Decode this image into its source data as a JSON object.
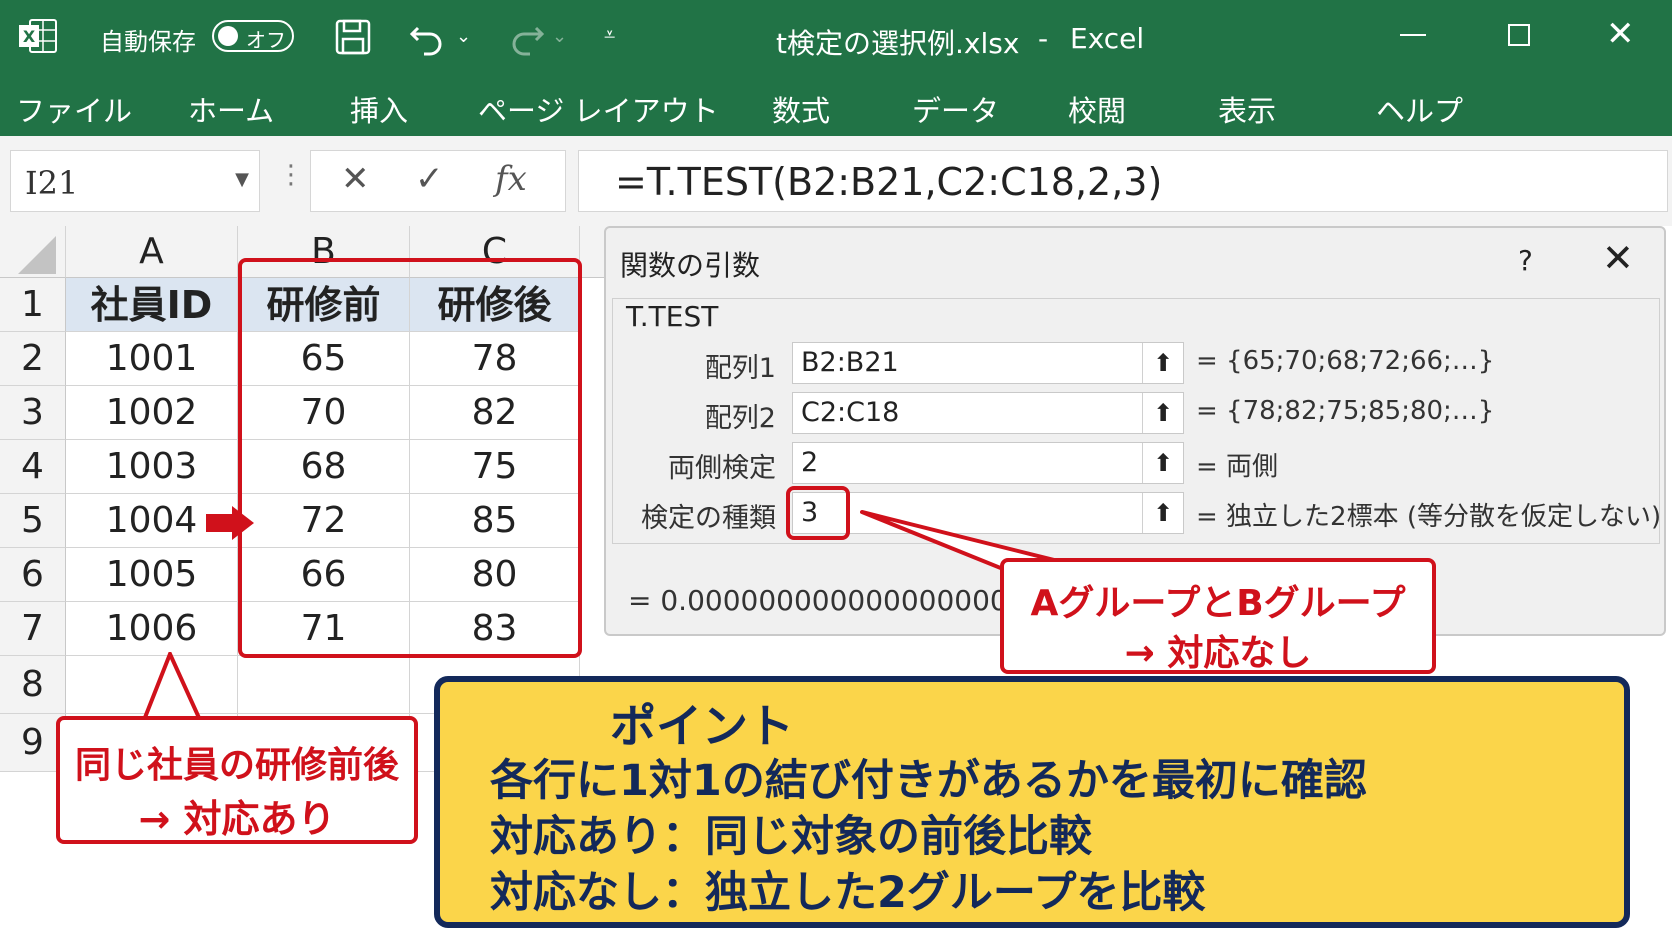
{
  "titlebar": {
    "autosave_label": "自動保存",
    "autosave_state": "オフ",
    "filename": "t検定の選択例.xlsx",
    "separator": "-",
    "app_name": "Excel"
  },
  "ribbon": {
    "tabs": [
      "ファイル",
      "ホーム",
      "挿入",
      "ページ レイアウト",
      "数式",
      "データ",
      "校閲",
      "表示",
      "ヘルプ"
    ]
  },
  "formula_bar": {
    "name_box": "I21",
    "formula": "=T.TEST(B2:B21,C2:C18,2,3)"
  },
  "sheet": {
    "columns": [
      "A",
      "B",
      "C"
    ],
    "rows": [
      "1",
      "2",
      "3",
      "4",
      "5",
      "6",
      "7",
      "8",
      "9"
    ],
    "headers": [
      "社員ID",
      "研修前",
      "研修後"
    ],
    "data": [
      [
        "1001",
        "65",
        "78"
      ],
      [
        "1002",
        "70",
        "82"
      ],
      [
        "1003",
        "68",
        "75"
      ],
      [
        "1004",
        "72",
        "85"
      ],
      [
        "1005",
        "66",
        "80"
      ],
      [
        "1006",
        "71",
        "83"
      ]
    ]
  },
  "dialog": {
    "title": "関数の引数",
    "help": "?",
    "function_name": "T.TEST",
    "args": [
      {
        "label": "配列1",
        "value": "B2:B21",
        "result": "=  {65;70;68;72;66;…}"
      },
      {
        "label": "配列2",
        "value": "C2:C18",
        "result": "=  {78;82;75;85;80;…}"
      },
      {
        "label": "両側検定",
        "value": "2",
        "result": "=  両側"
      },
      {
        "label": "検定の種類",
        "value": "3",
        "result": "=  独立した2標本 (等分散を仮定しない)"
      }
    ],
    "formula_result": "=   0.000000000000000000"
  },
  "annotations": {
    "left_callout_line1": "同じ社員の研修前後",
    "left_callout_line2": "→ 対応あり",
    "right_callout_line1": "AグループとBグループ",
    "right_callout_line2": "→ 対応なし",
    "point_title": "ポイント",
    "point_lines": [
      "各行に1対1の結び付きがあるかを最初に確認",
      "対応あり：同じ対象の前後比較",
      "対応なし：独立した2グループを比較"
    ],
    "accent_red": "#d0111b",
    "point_bg": "#fbd54a",
    "point_border": "#13295a"
  }
}
